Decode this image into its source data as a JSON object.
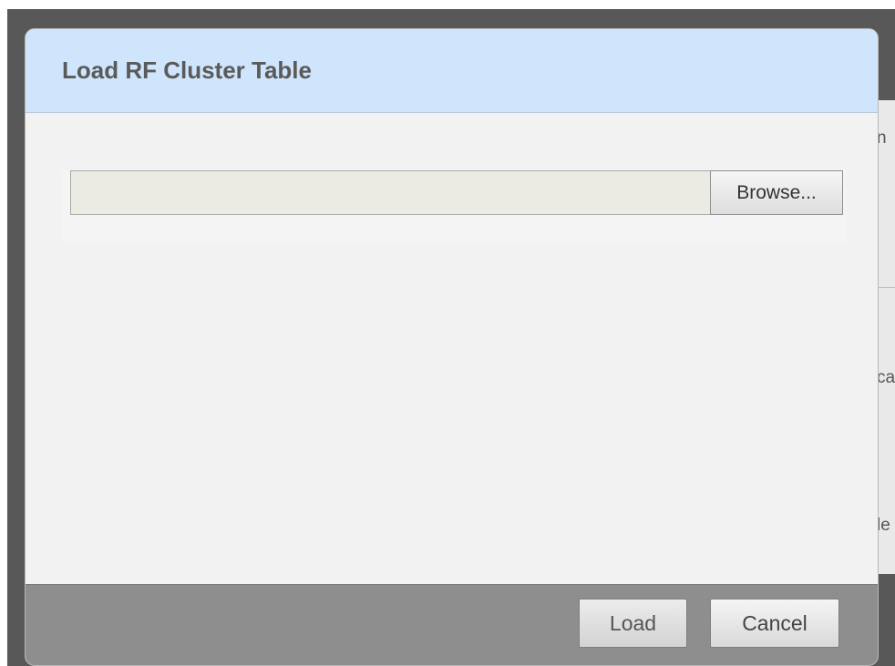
{
  "backdrop": {
    "fragments": [
      "n",
      "ca",
      "le"
    ]
  },
  "dialog": {
    "title": "Load RF Cluster Table",
    "file_input": {
      "value": "",
      "browse_label": "Browse..."
    },
    "footer": {
      "load_label": "Load",
      "cancel_label": "Cancel"
    }
  },
  "colors": {
    "header_bg": "#cfe5fb",
    "footer_bg": "#8e8e8e",
    "body_bg": "#f2f2f2",
    "overlay": "#585858"
  }
}
